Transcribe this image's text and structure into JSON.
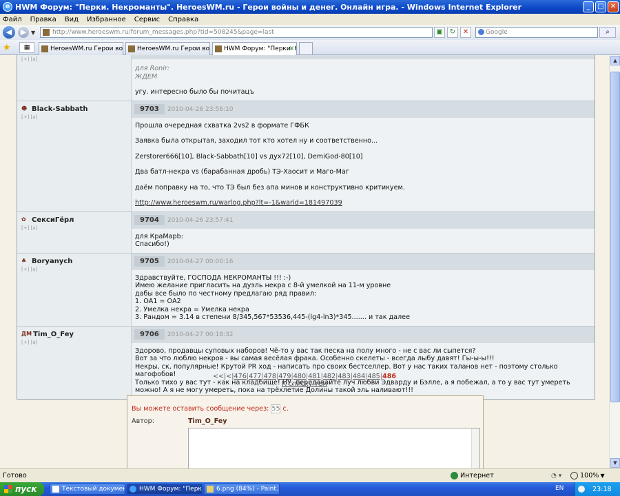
{
  "window": {
    "title": "HWM Форум: \"Перки. Некроманты\". HeroesWM.ru - Герои войны и денег. Онлайн игра. - Windows Internet Explorer",
    "btn_min": "_",
    "btn_max": "□",
    "btn_close": "✕"
  },
  "menu": [
    "Файл",
    "Правка",
    "Вид",
    "Избранное",
    "Сервис",
    "Справка"
  ],
  "address": {
    "url": "http://www.heroeswm.ru/forum_messages.php?tid=508245&page=last"
  },
  "search": {
    "placeholder": "Google"
  },
  "tabs": [
    {
      "label": "HeroesWM.ru Герои войны ..."
    },
    {
      "label": "HeroesWM.ru Герои войны ..."
    },
    {
      "label": "HWM Форум: \"Перки. Не...\""
    }
  ],
  "posts": [
    {
      "author": "",
      "links": "[+] [a]",
      "number": "",
      "date": "",
      "quote": "для Ronir:\nЖДЕМ",
      "paragraphs": [
        "угу. интересно было бы почитацъ"
      ]
    },
    {
      "author": "Black-Sabbath",
      "links": "[+] [a]",
      "number": "9703",
      "date": "2010-04-26 23:56:10",
      "paragraphs": [
        "Прошла очередная схватка 2vs2 в формате ГФБК",
        "Заявка была открытая, заходил тот кто хотел ну и соответственно...",
        "Zerstorer666[10], Black-Sabbath[10] vs дух72[10], DemiGod-80[10]",
        "Два батл-некра vs (барабанная дробь) ТЭ-Хаосит и Маго-Маг",
        "даём поправку на то, что ТЭ был без апа минов и конструктивно критикуем."
      ],
      "link": "http://www.heroeswm.ru/warlog.php?lt=-1&warid=181497039"
    },
    {
      "author": "СексиГёрл",
      "links": "[+] [a]",
      "number": "9704",
      "date": "2010-04-26 23:57:41",
      "paragraphs": [
        "для КраМарb:\nСпасибо!)"
      ]
    },
    {
      "author": "Boryanych",
      "links": "[+] [a]",
      "number": "9705",
      "date": "2010-04-27 00:00:16",
      "paragraphs": [
        "Здравствуйте, ГОСПОДА НЕКРОМАНТЫ !!! :-)\nИмею желание пригласить на дуэль некра с 8-й умелкой на 11-м уровне\nдабы все было по честному предлагаю ряд правил:\n1. ОА1 = ОА2\n2. Умелка некра = Умелка некра\n3. Рандом = 3.14 в степени 8/345,567*53536,445-(lg4-ln3)*345....... и так далее"
      ]
    },
    {
      "author": "Tim_O_Fey",
      "clan": "ДМ",
      "links": "[+] [a]",
      "number": "9706",
      "date": "2010-04-27 00:18:32",
      "paragraphs": [
        "Здорово, продавцы суповых наборов! Чё-то у вас так песка на полу много - не с вас ли сыпется?\nВот за что люблю некров - вы самая весёлая фрака. Особенно скелеты - всегда лыбу давят! Гы-ы-ы!!!\nНекры, ск, популярные! Крутой PR ход - написать про своих бестселлер. Вот у нас таких таланов нет - поэтому столько магофобов!\nТолько тихо у вас тут - как на кладбище! НУ, передавайте луч любви Эдварду и Бэлле, а я побежал, а то у вас тут умереть можно! А я не могу умереть, пока на трёхлетие Долины такой эль наливают!!!"
      ]
    }
  ],
  "pager": {
    "prefix": "<<|<|",
    "pages": [
      "476",
      "477",
      "478",
      "479",
      "480",
      "481",
      "482",
      "483",
      "484",
      "485"
    ],
    "current": "486",
    "back": "К списку тем"
  },
  "reply": {
    "wait_prefix": "Вы можете оставить сообщение через:",
    "wait_value": "55",
    "wait_suffix": "с.",
    "author_label": "Автор:",
    "author_name": "Tim_O_Fey"
  },
  "status": {
    "text": "Готово",
    "zone": "Интернет",
    "zoom": "100%"
  },
  "taskbar": {
    "start": "пуск",
    "tasks": [
      "Текстовый докумен...",
      "HWM Форум: \"Перки...",
      "6.png (84%) - Paint...."
    ],
    "lang": "EN",
    "time": "23:18"
  }
}
